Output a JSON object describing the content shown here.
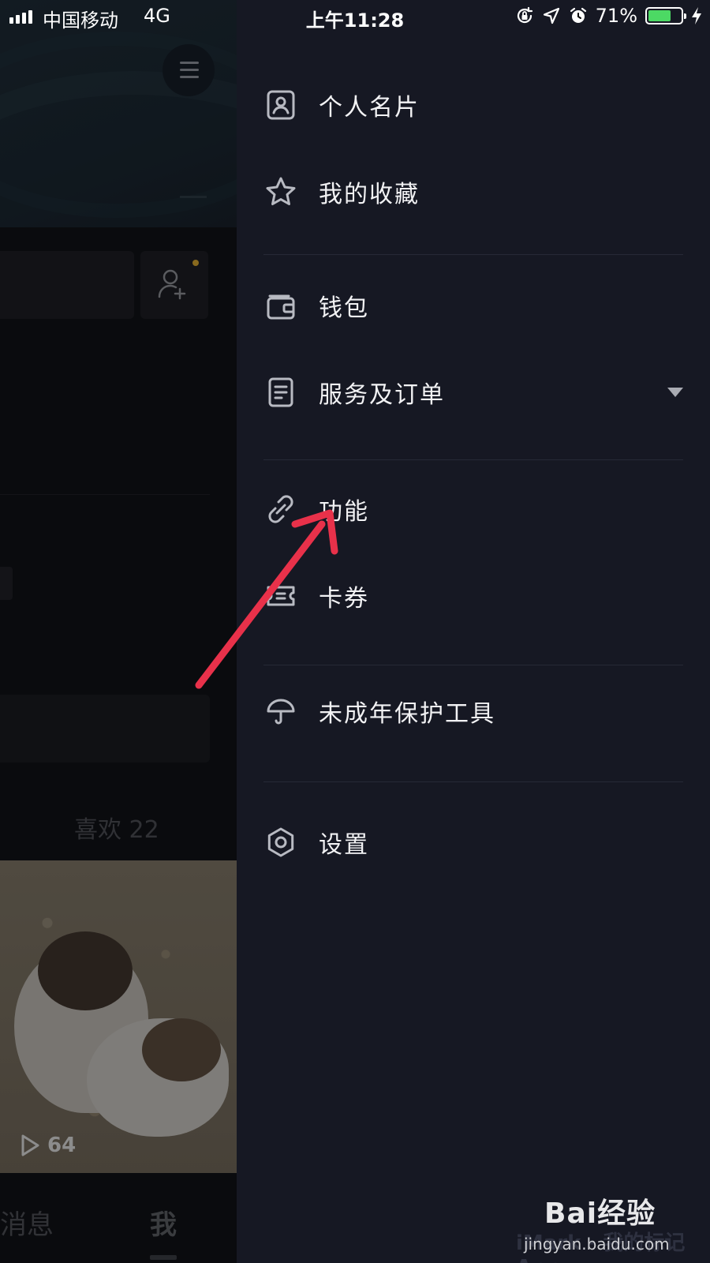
{
  "status_bar": {
    "carrier": "中国移动",
    "network": "4G",
    "time": "上午11:28",
    "battery_percent": "71%",
    "battery_level": 0.71,
    "icons": [
      "orientation-lock-icon",
      "location-icon",
      "alarm-icon",
      "charging-icon"
    ]
  },
  "background_page": {
    "likes_label": "喜欢 22",
    "video_play_count": "64",
    "bottom_tabs": [
      "消息",
      "我"
    ]
  },
  "drawer": {
    "groups": [
      [
        {
          "label": "个人名片",
          "icon": "profile-card-icon"
        },
        {
          "label": "我的收藏",
          "icon": "star-icon"
        }
      ],
      [
        {
          "label": "钱包",
          "icon": "wallet-icon"
        },
        {
          "label": "服务及订单",
          "icon": "document-icon",
          "expandable": true
        }
      ],
      [
        {
          "label": "功能",
          "icon": "link-icon"
        },
        {
          "label": "卡券",
          "icon": "ticket-icon"
        }
      ],
      [
        {
          "label": "未成年保护工具",
          "icon": "umbrella-icon"
        }
      ],
      [
        {
          "label": "设置",
          "icon": "settings-icon"
        }
      ]
    ]
  },
  "annotation": {
    "color": "#e8314a",
    "target": "功能"
  },
  "watermark": {
    "brand": "Bai经验",
    "url": "jingyan.baidu.com",
    "overlay_text": "iMark · 我的标记 App"
  }
}
